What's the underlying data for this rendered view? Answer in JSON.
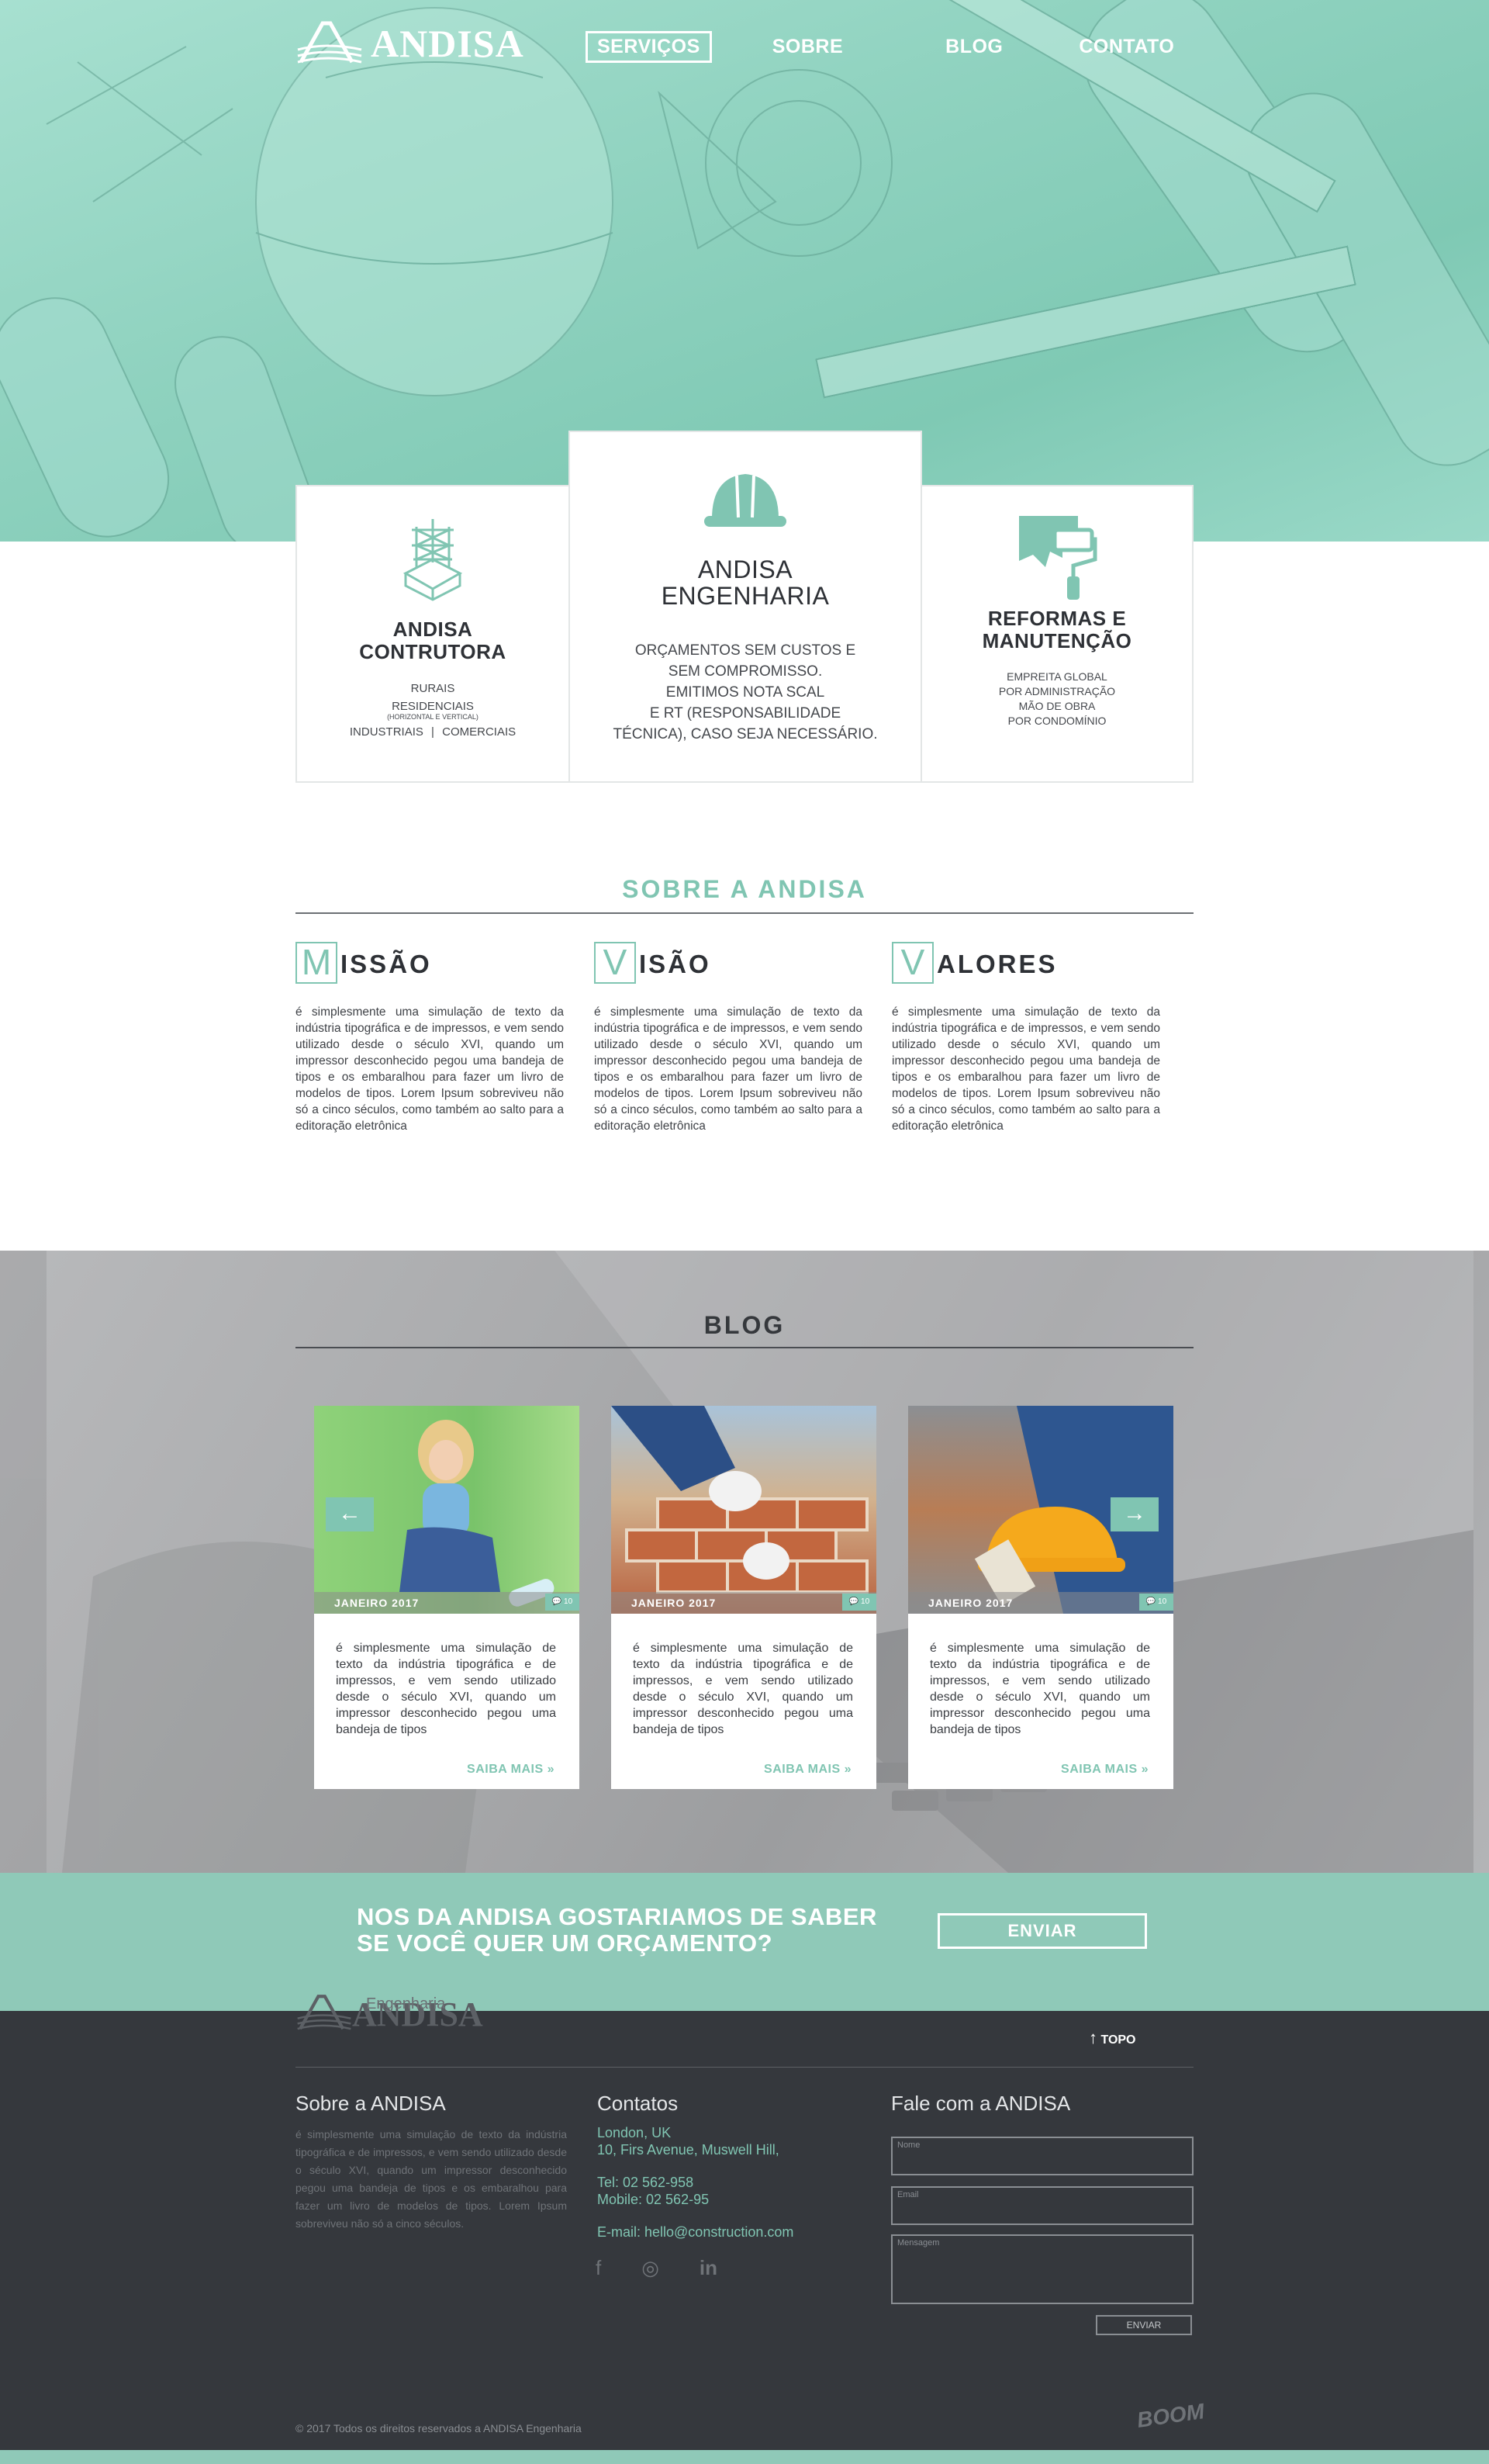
{
  "brand": {
    "name": "ANDISA",
    "footer_sub": "Engenharia"
  },
  "nav": [
    {
      "label": "SERVIÇOS"
    },
    {
      "label": "SOBRE"
    },
    {
      "label": "BLOG"
    },
    {
      "label": "CONTATO"
    }
  ],
  "services": {
    "left": {
      "title_1": "ANDISA",
      "title_2": "CONTRUTORA",
      "item_1": "RURAIS",
      "item_2": "RESIDENCIAIS",
      "item_2_note": "(HORIZONTAL E VERTICAL)",
      "item_3": "INDUSTRIAIS",
      "item_4": "COMERCIAIS",
      "separator": "|"
    },
    "center": {
      "title_1": "ANDISA",
      "title_2": "ENGENHARIA",
      "line_1": "ORÇAMENTOS SEM CUSTOS E",
      "line_2": "SEM COMPROMISSO.",
      "line_3": "EMITIMOS NOTA SCAL",
      "line_4": "E RT (RESPONSABILIDADE",
      "line_5": "TÉCNICA), CASO SEJA NECESSÁRIO."
    },
    "right": {
      "title_1": "REFORMAS E",
      "title_2": "MANUTENÇÃO",
      "line_1": "EMPREITA GLOBAL",
      "line_2": "POR ADMINISTRAÇÃO",
      "line_3": "MÃO DE OBRA",
      "line_4": "POR CONDOMÍNIO"
    }
  },
  "about": {
    "title": "SOBRE A ANDISA",
    "columns": [
      {
        "letter": "M",
        "rest": "ISSÃO",
        "text": "é simplesmente uma simulação de texto da indústria tipográfica e de impressos, e vem sendo utilizado desde o século XVI, quando um impressor desconhecido pegou uma bandeja de tipos e os embaralhou para fazer um livro de modelos de tipos. Lorem Ipsum sobreviveu não só a cinco séculos, como também ao salto para a editoração eletrônica"
      },
      {
        "letter": "V",
        "rest": "ISÃO",
        "text": "é simplesmente uma simulação de texto da indústria tipográfica e de impressos, e vem sendo utilizado desde o século XVI, quando um impressor desconhecido pegou uma bandeja de tipos e os embaralhou para fazer um livro de modelos de tipos. Lorem Ipsum sobreviveu não só a cinco séculos, como também ao salto para a editoração eletrônica"
      },
      {
        "letter": "V",
        "rest": "ALORES",
        "text": "é simplesmente uma simulação de texto da indústria tipográfica e de impressos, e vem sendo utilizado desde o século XVI, quando um impressor desconhecido pegou uma bandeja de tipos e os embaralhou para fazer um livro de modelos de tipos. Lorem Ipsum sobreviveu não só a cinco séculos, como também ao salto para a editoração eletrônica"
      }
    ]
  },
  "blog": {
    "title": "BLOG",
    "prev_arrow": "←",
    "next_arrow": "→",
    "posts": [
      {
        "date": "JANEIRO 2017",
        "count": "💬 10",
        "text": "é simplesmente uma simulação de texto da indústria tipográfica e de impressos, e vem sendo utilizado desde o século XVI, quando um impressor desconhecido pegou uma bandeja de tipos",
        "more": "SAIBA MAIS »"
      },
      {
        "date": "JANEIRO 2017",
        "count": "💬 10",
        "text": "é simplesmente uma simulação de texto da indústria tipográfica e de impressos, e vem sendo utilizado desde o século XVI, quando um impressor desconhecido pegou uma bandeja de tipos",
        "more": "SAIBA MAIS »"
      },
      {
        "date": "JANEIRO 2017",
        "count": "💬 10",
        "text": "é simplesmente uma simulação de texto da indústria tipográfica e de impressos, e vem sendo utilizado desde o século XVI, quando um impressor desconhecido pegou uma bandeja de tipos",
        "more": "SAIBA MAIS »"
      }
    ]
  },
  "cta": {
    "line_1": "NOS DA ANDISA GOSTARIAMOS  DE SABER",
    "line_2": "SE VOCÊ QUER UM ORÇAMENTO?",
    "button": "ENVIAR"
  },
  "footer": {
    "topo": "TOPO",
    "about_title": "Sobre a ANDISA",
    "about_text": "é simplesmente uma simulação de texto da indústria tipográfica e de impressos, e vem sendo utilizado desde o século XVI, quando um impressor desconhecido pegou uma bandeja de tipos e os embaralhou para fazer um livro de modelos de tipos. Lorem Ipsum sobreviveu não só a cinco séculos.",
    "contacts_title": "Contatos",
    "address_1": "London, UK",
    "address_2": "10, Firs Avenue, Muswell Hill,",
    "tel": "Tel: 02 562-958",
    "mobile": "Mobile: 02 562-95",
    "email": "E-mail: hello@construction.com",
    "social": {
      "facebook": "f",
      "instagram": "◎",
      "linkedin": "in"
    },
    "form_title": "Fale com a ANDISA",
    "field_name": "Nome",
    "field_email": "Email",
    "field_message": "Mensagem",
    "send": "ENVIAR",
    "copyright": "© 2017  Todos os direitos reservados a ANDISA Engenharia",
    "credit": "BOOM"
  },
  "colors": {
    "accent": "#80c5b2",
    "hero": "#8fd2bf",
    "dark": "#35383d"
  },
  "icons": [
    "structure-icon",
    "helmet-icon",
    "paint-roller-icon",
    "arrow-left-icon",
    "arrow-right-icon",
    "arrow-up-icon",
    "comment-icon",
    "facebook-icon",
    "instagram-icon",
    "linkedin-icon"
  ]
}
